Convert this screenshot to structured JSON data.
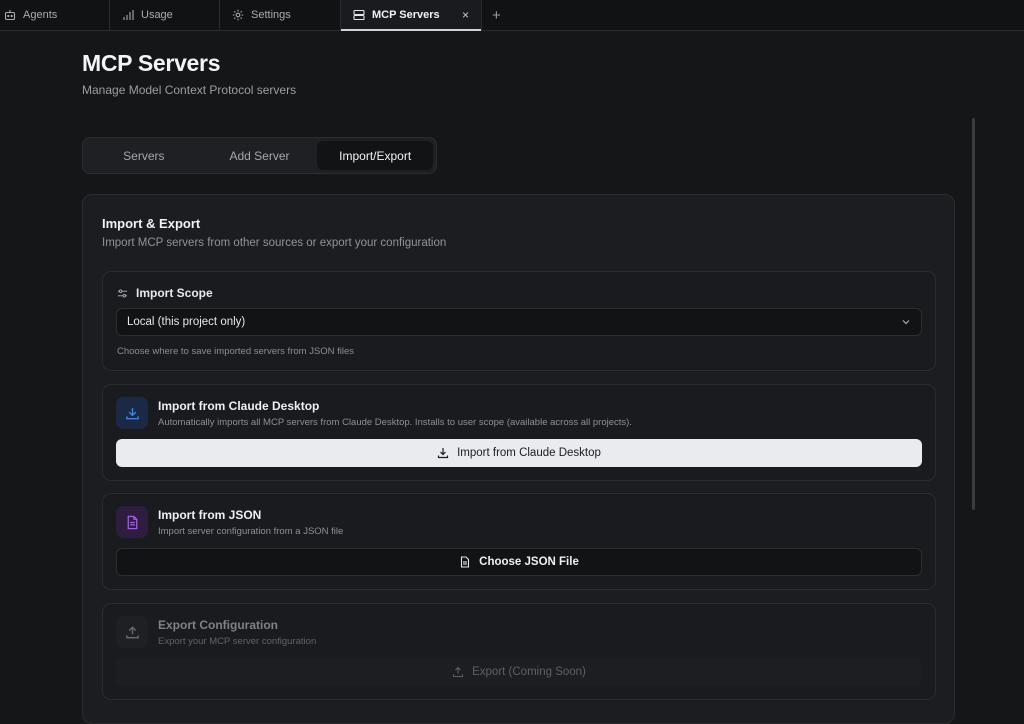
{
  "tabs": [
    {
      "label": "Agents",
      "icon": "bot-icon"
    },
    {
      "label": "Usage",
      "icon": "bar-chart-icon"
    },
    {
      "label": "Settings",
      "icon": "gear-icon"
    },
    {
      "label": "MCP Servers",
      "icon": "server-icon",
      "active": true,
      "close": "×"
    }
  ],
  "new_tab": "+",
  "page": {
    "title": "MCP Servers",
    "subtitle": "Manage Model Context Protocol servers"
  },
  "segments": [
    "Servers",
    "Add Server",
    "Import/Export"
  ],
  "active_segment": "Import/Export",
  "panel": {
    "title": "Import & Export",
    "subtitle": "Import MCP servers from other sources or export your configuration"
  },
  "scope": {
    "label": "Import Scope",
    "selected": "Local (this project only)",
    "help": "Choose where to save imported servers from JSON files"
  },
  "claude_import": {
    "title": "Import from Claude Desktop",
    "description": "Automatically imports all MCP servers from Claude Desktop. Installs to user scope (available across all projects).",
    "button": "Import from Claude Desktop",
    "icon_color": "#3b82f6"
  },
  "json_import": {
    "title": "Import from JSON",
    "description": "Import server configuration from a JSON file",
    "button": "Choose JSON File",
    "icon_color": "#a855f7"
  },
  "export": {
    "title": "Export Configuration",
    "description": "Export your MCP server configuration",
    "button": "Export (Coming Soon)"
  }
}
